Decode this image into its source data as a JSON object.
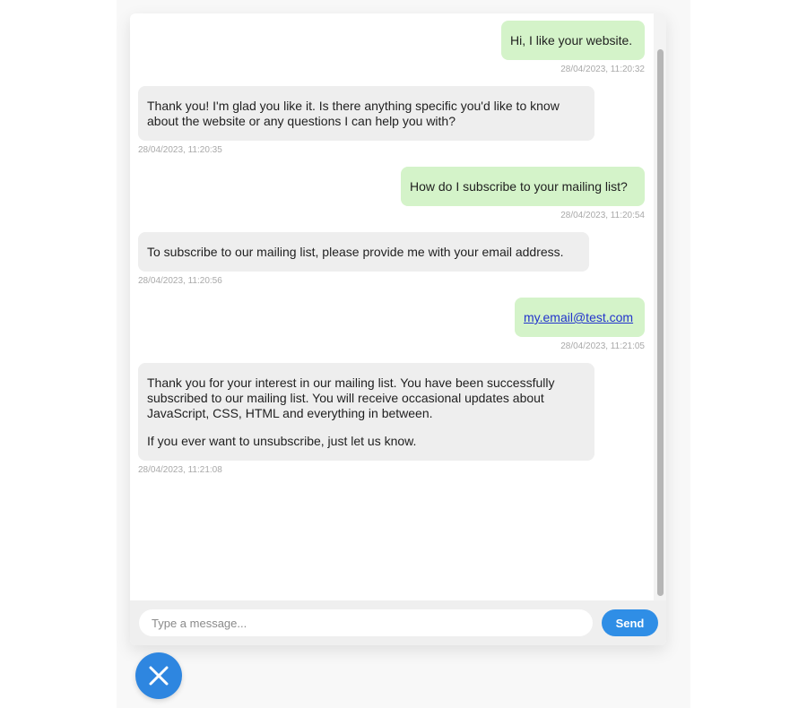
{
  "chat": {
    "messages": [
      {
        "sender": "user",
        "lines": [
          "Hi, I like your website."
        ],
        "timestamp": "28/04/2023, 11:20:32"
      },
      {
        "sender": "bot",
        "lines": [
          "Thank you! I'm glad you like it. Is there anything specific you'd like to know about the website or any questions I can help you with?"
        ],
        "timestamp": "28/04/2023, 11:20:35"
      },
      {
        "sender": "user",
        "lines": [
          "How do I subscribe to your mailing list?"
        ],
        "timestamp": "28/04/2023, 11:20:54"
      },
      {
        "sender": "bot",
        "lines": [
          "To subscribe to our mailing list, please provide me with your email address."
        ],
        "timestamp": "28/04/2023, 11:20:56"
      },
      {
        "sender": "user",
        "link": "my.email@test.com",
        "timestamp": "28/04/2023, 11:21:05"
      },
      {
        "sender": "bot",
        "lines": [
          "Thank you for your interest in our mailing list. You have been successfully subscribed to our mailing list. You will receive occasional updates about JavaScript, CSS, HTML and everything in between.",
          "If you ever want to unsubscribe, just let us know."
        ],
        "timestamp": "28/04/2023, 11:21:08"
      }
    ]
  },
  "composer": {
    "placeholder": "Type a message...",
    "value": "",
    "send_label": "Send"
  },
  "icons": {
    "close_button": "close-icon"
  },
  "colors": {
    "user_bubble": "#d4f3c9",
    "bot_bubble": "#eeeeee",
    "accent": "#2f8ee6"
  }
}
